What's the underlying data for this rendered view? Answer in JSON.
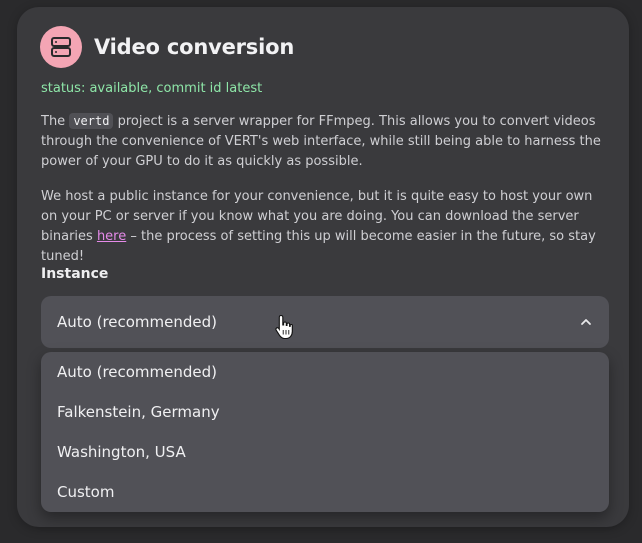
{
  "colors": {
    "accent_pink": "#f4a5b4",
    "status_green": "#8ee6a8",
    "link_pink": "#e58ae9"
  },
  "card": {
    "icon": "server-icon",
    "title": "Video conversion",
    "status": "status: available, commit id latest",
    "paragraph1": {
      "before": "The ",
      "code": "vertd",
      "after": " project is a server wrapper for FFmpeg. This allows you to convert videos through the convenience of VERT's web interface, while still being able to harness the power of your GPU to do it as quickly as possible."
    },
    "paragraph2": {
      "before": "We host a public instance for your convenience, but it is quite easy to host your own on your PC or server if you know what you are doing. You can download the server binaries ",
      "link": "here",
      "after": " – the process of setting this up will become easier in the future, so stay tuned!"
    },
    "instance": {
      "label": "Instance",
      "selected": "Auto (recommended)",
      "chevron_icon": "chevron-up-icon",
      "options": [
        "Auto (recommended)",
        "Falkenstein, Germany",
        "Washington, USA",
        "Custom"
      ]
    }
  }
}
